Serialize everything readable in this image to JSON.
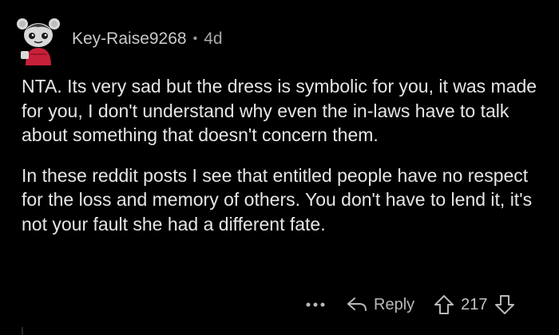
{
  "comment": {
    "username": "Key-Raise9268",
    "separator": "•",
    "age": "4d",
    "paragraphs": [
      "NTA. Its very sad but the dress is symbolic for you, it was made for you, I don't understand why even the in-laws have to talk about something that doesn't concern them.",
      "In these reddit posts I see that entitled people have no respect for the loss and memory of others. You don't have to lend it, it's not your fault she had a different fate."
    ],
    "actions": {
      "more_label": "•••",
      "reply_label": "Reply",
      "score": "217"
    }
  },
  "icons": {
    "avatar": "snoo-avatar-icon",
    "more": "more-options-icon",
    "reply": "reply-arrow-icon",
    "upvote": "upvote-arrow-icon",
    "downvote": "downvote-arrow-icon"
  },
  "colors": {
    "background": "#000000",
    "text": "#e6e6e6",
    "meta": "#a8a8a8",
    "avatar_bg": "#2c2c2c",
    "avatar_shirt": "#c8203a"
  }
}
